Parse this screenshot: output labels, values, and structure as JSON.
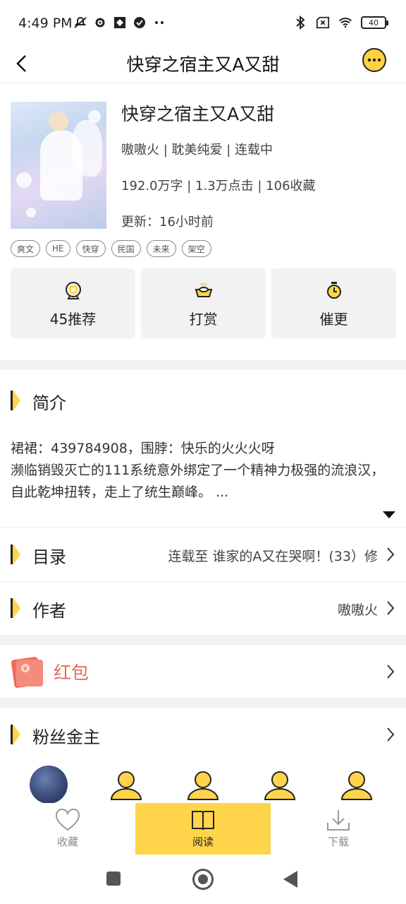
{
  "status": {
    "time": "4:49 PM",
    "battery": "40",
    "left_icons": [
      "mute-icon",
      "gear-icon",
      "app-icon",
      "check-circle-icon",
      "more-dots-icon"
    ],
    "right_icons": [
      "bluetooth-icon",
      "no-sim-icon",
      "wifi-icon",
      "battery-icon"
    ]
  },
  "header": {
    "title": "快穿之宿主又A又甜"
  },
  "book": {
    "title": "快穿之宿主又A又甜",
    "meta_author": "嗷嗷火 | 耽美纯爱 | 连载中",
    "meta_stats": "192.0万字 | 1.3万点击 | 106收藏",
    "meta_update": "更新：16小时前",
    "tags": [
      "爽文",
      "HE",
      "快穿",
      "民国",
      "未来",
      "架空"
    ]
  },
  "actions": [
    {
      "label": "45推荐",
      "icon": "recommend-icon"
    },
    {
      "label": "打赏",
      "icon": "gold-ingot-icon"
    },
    {
      "label": "催更",
      "icon": "stopwatch-icon"
    }
  ],
  "intro": {
    "title": "简介",
    "line1": "裙裙：439784908，围脖：快乐的火火火呀",
    "line2": "濒临销毁灭亡的111系统意外绑定了一个精神力极强的流浪汉，自此乾坤扭转，走上了统生巅峰。 ..."
  },
  "catalog": {
    "title": "目录",
    "value": "连载至 谁家的A又在哭啊！(33）修"
  },
  "author": {
    "title": "作者",
    "value": "嗷嗷火"
  },
  "redpack": {
    "title": "红包"
  },
  "fans": {
    "title": "粉丝金主"
  },
  "bottom": {
    "favorite": "收藏",
    "read": "阅读",
    "download": "下载"
  },
  "colors": {
    "accent": "#fed54a",
    "red": "#e26a5a"
  }
}
